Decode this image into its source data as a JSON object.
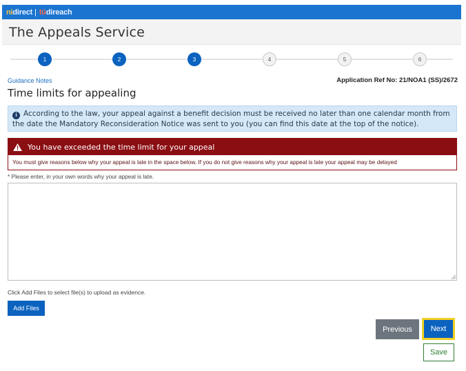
{
  "brand": {
    "logo_part1": "ni",
    "logo_part2": "direct",
    "logo_part3": "tú",
    "logo_part4": "direach"
  },
  "header": {
    "title": "The Appeals Service"
  },
  "stepper": {
    "current_step": 3,
    "steps": [
      {
        "label": "1",
        "status": "complete"
      },
      {
        "label": "2",
        "status": "complete"
      },
      {
        "label": "3",
        "status": "current"
      },
      {
        "label": "4",
        "status": "pending"
      },
      {
        "label": "5",
        "status": "pending"
      },
      {
        "label": "6",
        "status": "pending"
      }
    ]
  },
  "links": {
    "guidance": "Guidance Notes"
  },
  "application": {
    "ref_label": "Application Ref No: 21/NOA1 (SS)/2672"
  },
  "page": {
    "title": "Time limits for appealing"
  },
  "info_box": {
    "icon": "info-circle-icon",
    "text": "According to the law, your appeal against a benefit decision must be received no later than one calendar month from the date the Mandatory Reconsideration Notice was sent to you (you can find this date at the top of the notice)."
  },
  "alert": {
    "icon": "warning-triangle-icon",
    "heading": "You have exceeded the time limit for your appeal",
    "body": "You must give reasons below why your appeal is late in the space below. If you do not give reasons why your appeal is late your appeal may be delayed"
  },
  "form": {
    "reason_label": "* Please enter, in your own words why your appeal is late.",
    "reason_value": ""
  },
  "upload": {
    "hint": "Click Add Files to select file(s) to upload as evidence.",
    "button_label": "Add Files"
  },
  "actions": {
    "previous": "Previous",
    "next": "Next",
    "save": "Save"
  },
  "colors": {
    "brand_blue": "#1b75d0",
    "primary": "#0b62bf",
    "alert_red": "#8b0e13",
    "info_bg": "#d4e8f8",
    "secondary_grey": "#6c757d",
    "focus_yellow": "#f2d024",
    "success_green": "#2e7d32"
  }
}
